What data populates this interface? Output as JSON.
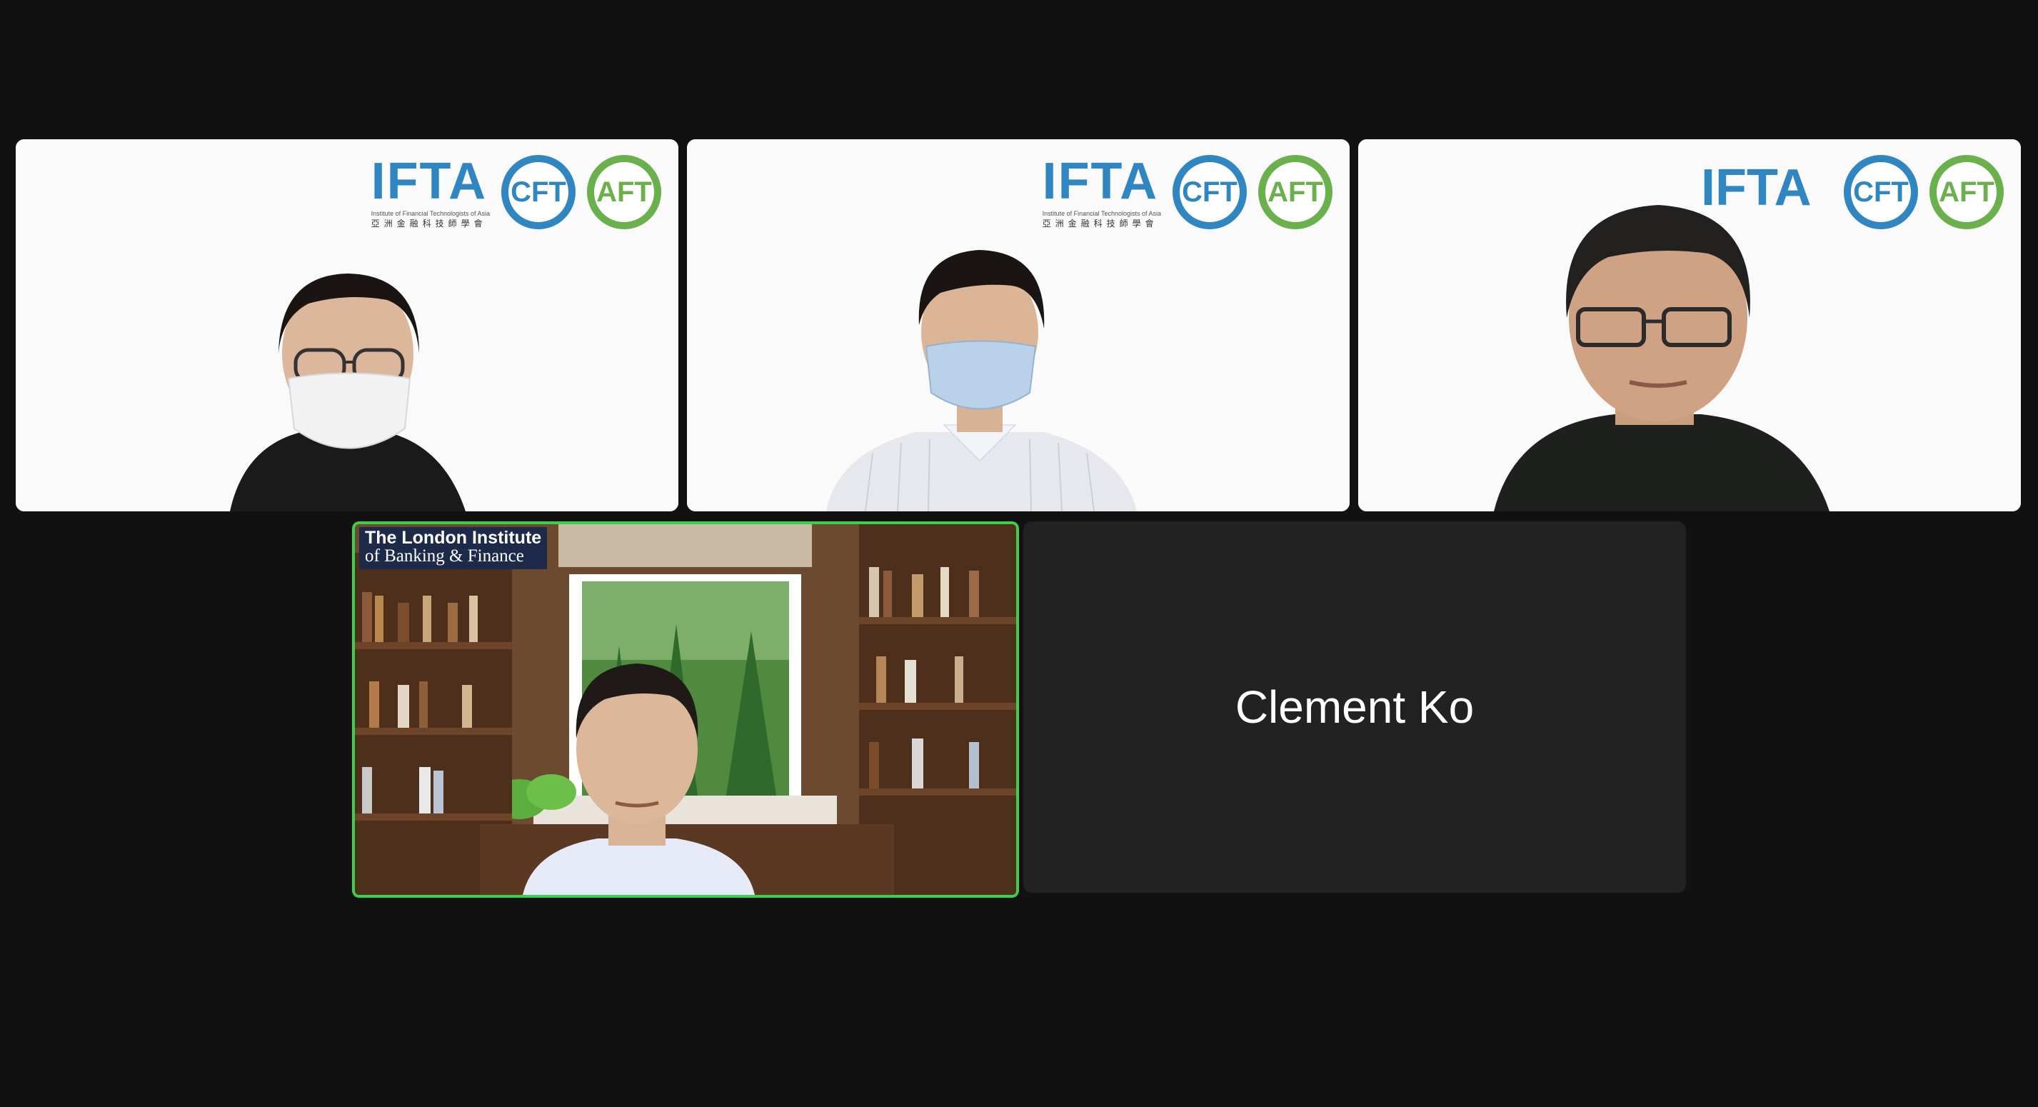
{
  "participants": [
    {
      "id": 1,
      "logo": {
        "main": "IFTA",
        "sub": "Institute of Financial Technologists of Asia",
        "sub_cn": "亞洲金融科技師學會",
        "badge1": "CFT",
        "badge2": "AFT"
      }
    },
    {
      "id": 2,
      "logo": {
        "main": "IFTA",
        "sub": "Institute of Financial Technologists of Asia",
        "sub_cn": "亞洲金融科技師學會",
        "badge1": "CFT",
        "badge2": "AFT"
      }
    },
    {
      "id": 3,
      "logo": {
        "badge1": "CFT",
        "badge2": "AFT"
      }
    },
    {
      "id": 4,
      "active_speaker": true,
      "background_logo": {
        "line1": "The London Institute",
        "line2": "of Banking & Finance"
      }
    },
    {
      "id": 5,
      "display_name": "Clement Ko",
      "video_off": true
    }
  ],
  "colors": {
    "background": "#111111",
    "tile_off": "#222222",
    "active_speaker_border": "#3ecf4a",
    "ifta_blue": "#2f86c1",
    "aft_green": "#6ab04c"
  }
}
